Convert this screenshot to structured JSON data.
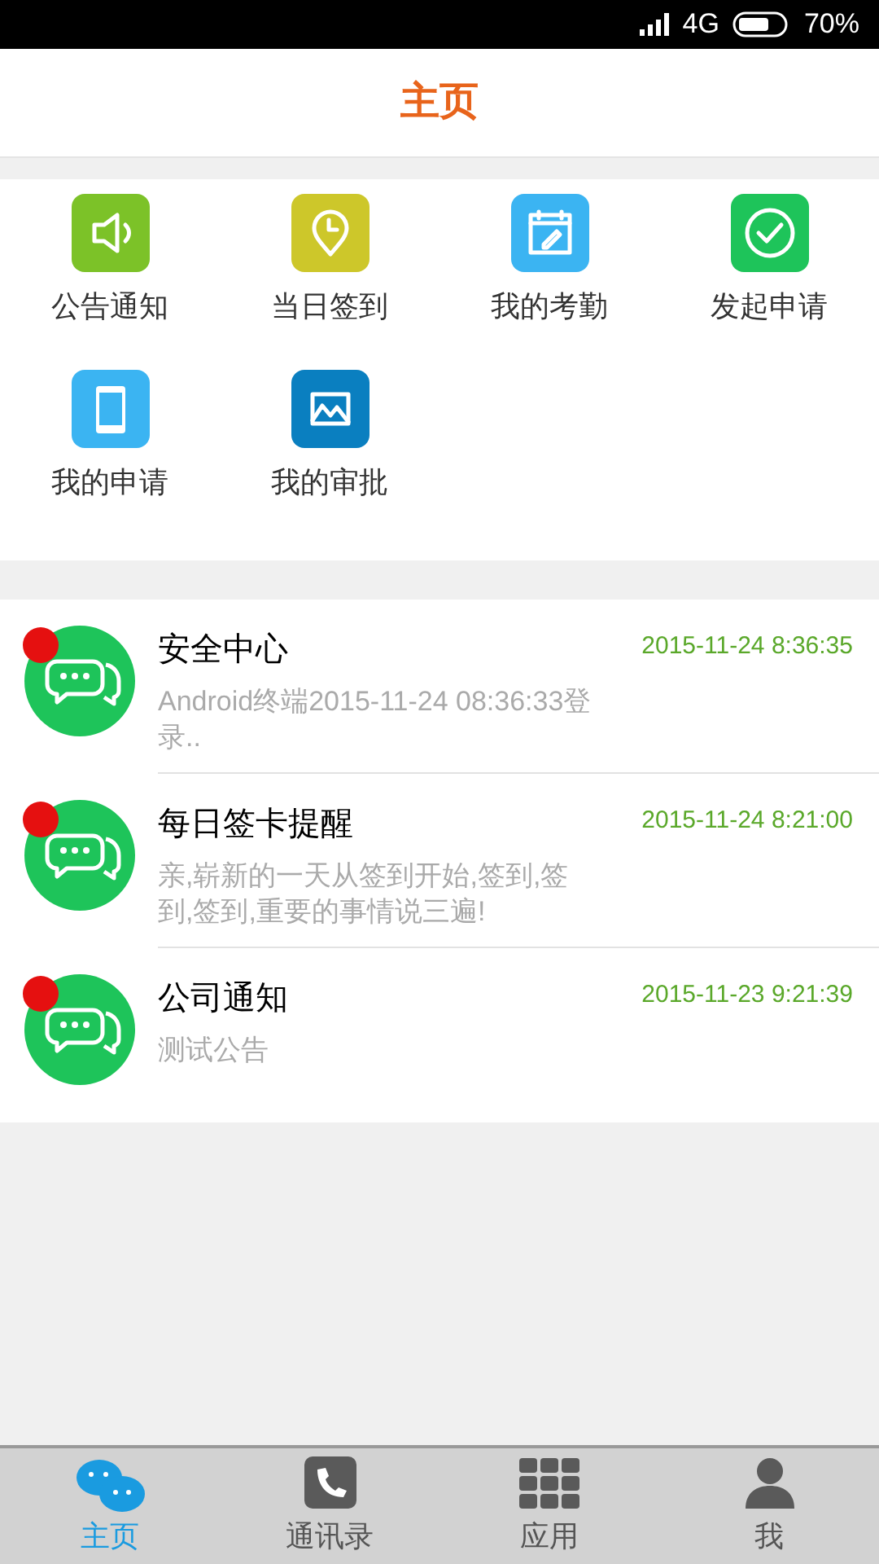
{
  "status_bar": {
    "network": "4G",
    "battery": "70%"
  },
  "header": {
    "title": "主页"
  },
  "shortcuts": [
    {
      "label": "公告通知",
      "kind": "speaker",
      "color": "#7cc228"
    },
    {
      "label": "当日签到",
      "kind": "pin",
      "color": "#cdc72a"
    },
    {
      "label": "我的考勤",
      "kind": "calendar",
      "color": "#3bb4f2"
    },
    {
      "label": "发起申请",
      "kind": "check",
      "color": "#1ec45a"
    },
    {
      "label": "我的申请",
      "kind": "phone",
      "color": "#3bb4f2"
    },
    {
      "label": "我的审批",
      "kind": "image",
      "color": "#0a7fc0"
    }
  ],
  "messages": [
    {
      "title": "安全中心",
      "time": "2015-11-24 8:36:35",
      "preview": "Android终端2015-11-24 08:36:33登录..",
      "unread": true
    },
    {
      "title": "每日签卡提醒",
      "time": "2015-11-24 8:21:00",
      "preview": "亲,崭新的一天从签到开始,签到,签到,签到,重要的事情说三遍!",
      "unread": true
    },
    {
      "title": "公司通知",
      "time": "2015-11-23 9:21:39",
      "preview": "测试公告",
      "unread": true
    }
  ],
  "tabs": [
    {
      "label": "主页",
      "kind": "chat",
      "selected": true
    },
    {
      "label": "通讯录",
      "kind": "phone",
      "selected": false
    },
    {
      "label": "应用",
      "kind": "grid",
      "selected": false
    },
    {
      "label": "我",
      "kind": "person",
      "selected": false
    }
  ]
}
